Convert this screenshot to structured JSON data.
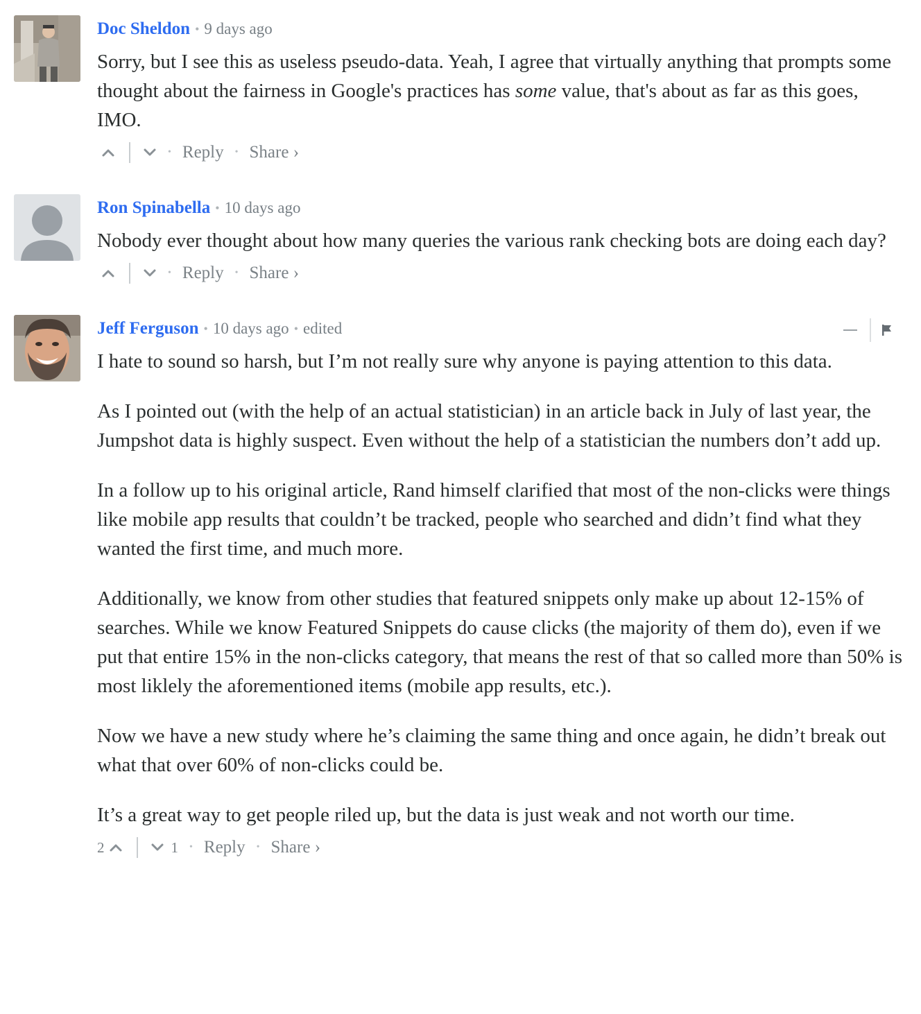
{
  "comments": [
    {
      "author": "Doc Sheldon",
      "time": "9 days ago",
      "text_before_em": "Sorry, but I see this as useless pseudo-data. Yeah, I agree that virtually anything that prompts some thought about the fairness in Google's practices has ",
      "em": "some",
      "text_after_em": " value, that's about as far as this goes, IMO.",
      "reply_label": "Reply",
      "share_label": "Share ›"
    },
    {
      "author": "Ron Spinabella",
      "time": "10 days ago",
      "text": "Nobody ever thought about how many queries the various rank checking bots are doing each day?",
      "reply_label": "Reply",
      "share_label": "Share ›"
    },
    {
      "author": "Jeff Ferguson",
      "time": "10 days ago",
      "edited": "edited",
      "paragraphs": [
        "I hate to sound so harsh, but I’m not really sure why anyone is paying attention to this data.",
        "As I pointed out (with the help of an actual statistician) in an article back in July of last year, the Jumpshot data is highly suspect. Even without the help of a statistician the numbers don’t add up.",
        "In a follow up to his original article, Rand himself clarified that most of the non-clicks were things like mobile app results that couldn’t be tracked, people who searched and didn’t find what they wanted the first time, and much more.",
        "Additionally, we know from other studies that featured snippets only make up about 12-15% of searches. While we know Featured Snippets do cause clicks (the majority of them do), even if we put that entire 15% in the non-clicks category, that means the rest of that so called more than 50% is most liklely the aforementioned items (mobile app results, etc.).",
        "Now we have a new study where he’s claiming the same thing and once again, he didn’t break out what that over 60% of non-clicks could be.",
        "It’s a great way to get people riled up, but the data is just weak and not worth our time."
      ],
      "upvotes": "2",
      "downvotes": "1",
      "reply_label": "Reply",
      "share_label": "Share ›"
    }
  ],
  "icons": {
    "upvote": "chevron-up-icon",
    "downvote": "chevron-down-icon",
    "collapse": "minus-icon",
    "flag": "flag-icon"
  },
  "colors": {
    "author_link": "#2e6cf0",
    "text": "#2a2e2e",
    "muted": "#7b8287"
  }
}
